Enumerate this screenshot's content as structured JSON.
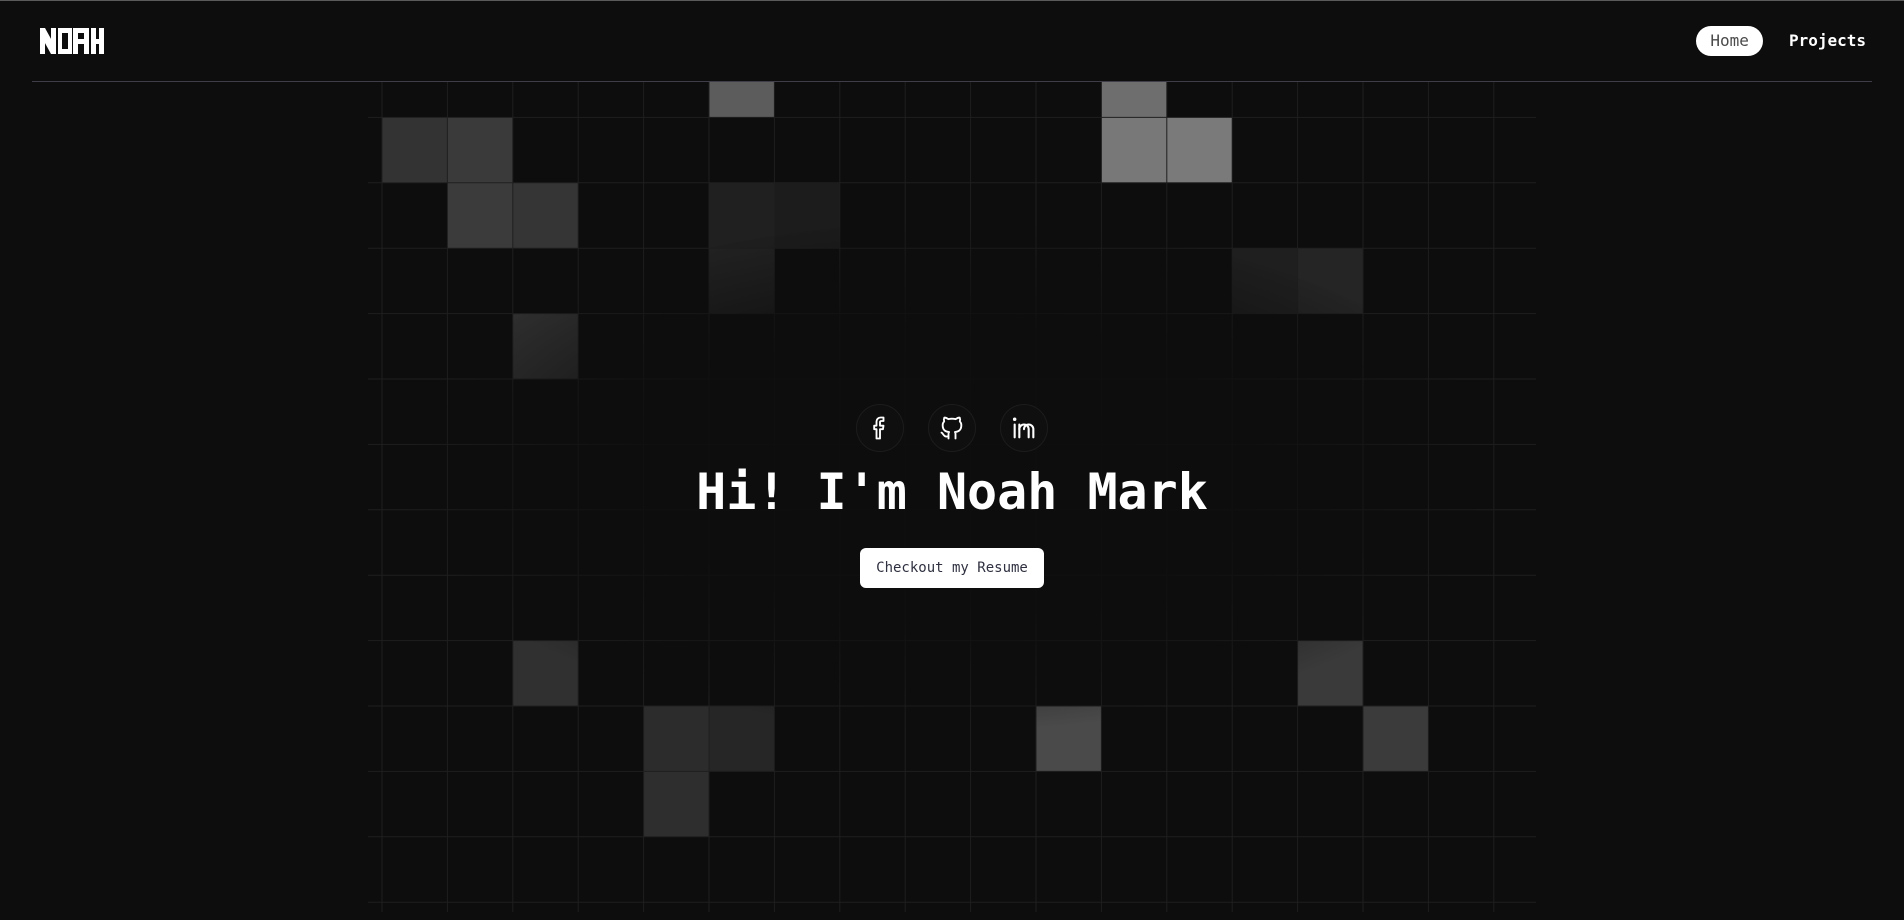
{
  "header": {
    "logo_text": "NOAH",
    "nav": [
      {
        "label": "Home",
        "active": true
      },
      {
        "label": "Projects",
        "active": false
      }
    ]
  },
  "hero": {
    "socials": [
      {
        "icon": "facebook-icon"
      },
      {
        "icon": "github-icon"
      },
      {
        "icon": "linkedin-icon"
      }
    ],
    "title": "Hi! I'm Noah Mark",
    "resume_button": "Checkout my Resume"
  },
  "colors": {
    "background": "#0d0d0d",
    "text": "#ffffff",
    "button_bg": "#ffffff",
    "button_text": "#2f3140"
  }
}
